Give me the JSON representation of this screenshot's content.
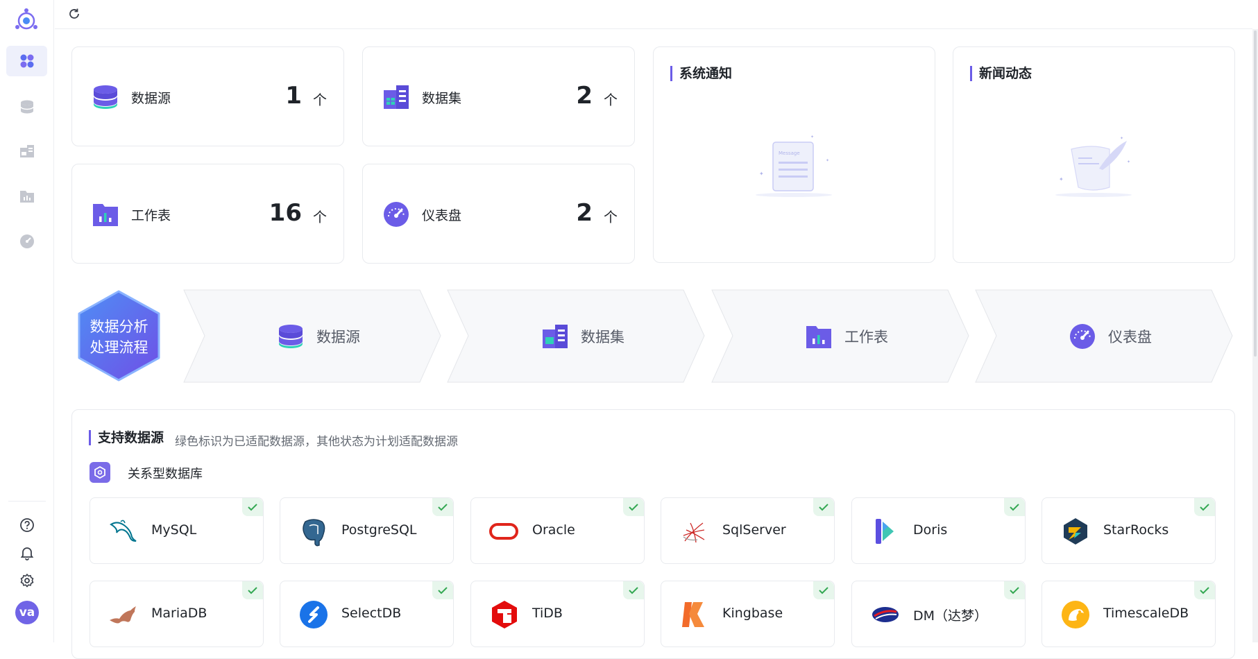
{
  "sidebar": {
    "nav": [
      "workbench",
      "datasource",
      "dataset",
      "worksheet",
      "dashboard"
    ],
    "avatar_text": "va"
  },
  "stats": [
    {
      "label": "数据源",
      "count": "1",
      "unit": "个"
    },
    {
      "label": "数据集",
      "count": "2",
      "unit": "个"
    },
    {
      "label": "工作表",
      "count": "16",
      "unit": "个"
    },
    {
      "label": "仪表盘",
      "count": "2",
      "unit": "个"
    }
  ],
  "panels": {
    "notice_title": "系统通知",
    "news_title": "新闻动态",
    "notice_illustration_text": "Message"
  },
  "flow": {
    "title_line1": "数据分析",
    "title_line2": "处理流程",
    "steps": [
      "数据源",
      "数据集",
      "工作表",
      "仪表盘"
    ]
  },
  "datasources": {
    "title": "支持数据源",
    "subtitle": "绿色标识为已适配数据源，其他状态为计划适配数据源",
    "category": "关系型数据库",
    "items": [
      {
        "name": "MySQL",
        "icon": "mysql-icon"
      },
      {
        "name": "PostgreSQL",
        "icon": "postgresql-icon"
      },
      {
        "name": "Oracle",
        "icon": "oracle-icon"
      },
      {
        "name": "SqlServer",
        "icon": "sqlserver-icon"
      },
      {
        "name": "Doris",
        "icon": "doris-icon"
      },
      {
        "name": "StarRocks",
        "icon": "starrocks-icon"
      },
      {
        "name": "MariaDB",
        "icon": "mariadb-icon"
      },
      {
        "name": "SelectDB",
        "icon": "selectdb-icon"
      },
      {
        "name": "TiDB",
        "icon": "tidb-icon"
      },
      {
        "name": "Kingbase",
        "icon": "kingbase-icon"
      },
      {
        "name": "DM（达梦）",
        "icon": "dm-icon"
      },
      {
        "name": "TimescaleDB",
        "icon": "timescaledb-icon"
      }
    ]
  },
  "colors": {
    "accent": "#6b5ce7",
    "check_bg": "#e7f6ec",
    "check": "#34a853"
  }
}
